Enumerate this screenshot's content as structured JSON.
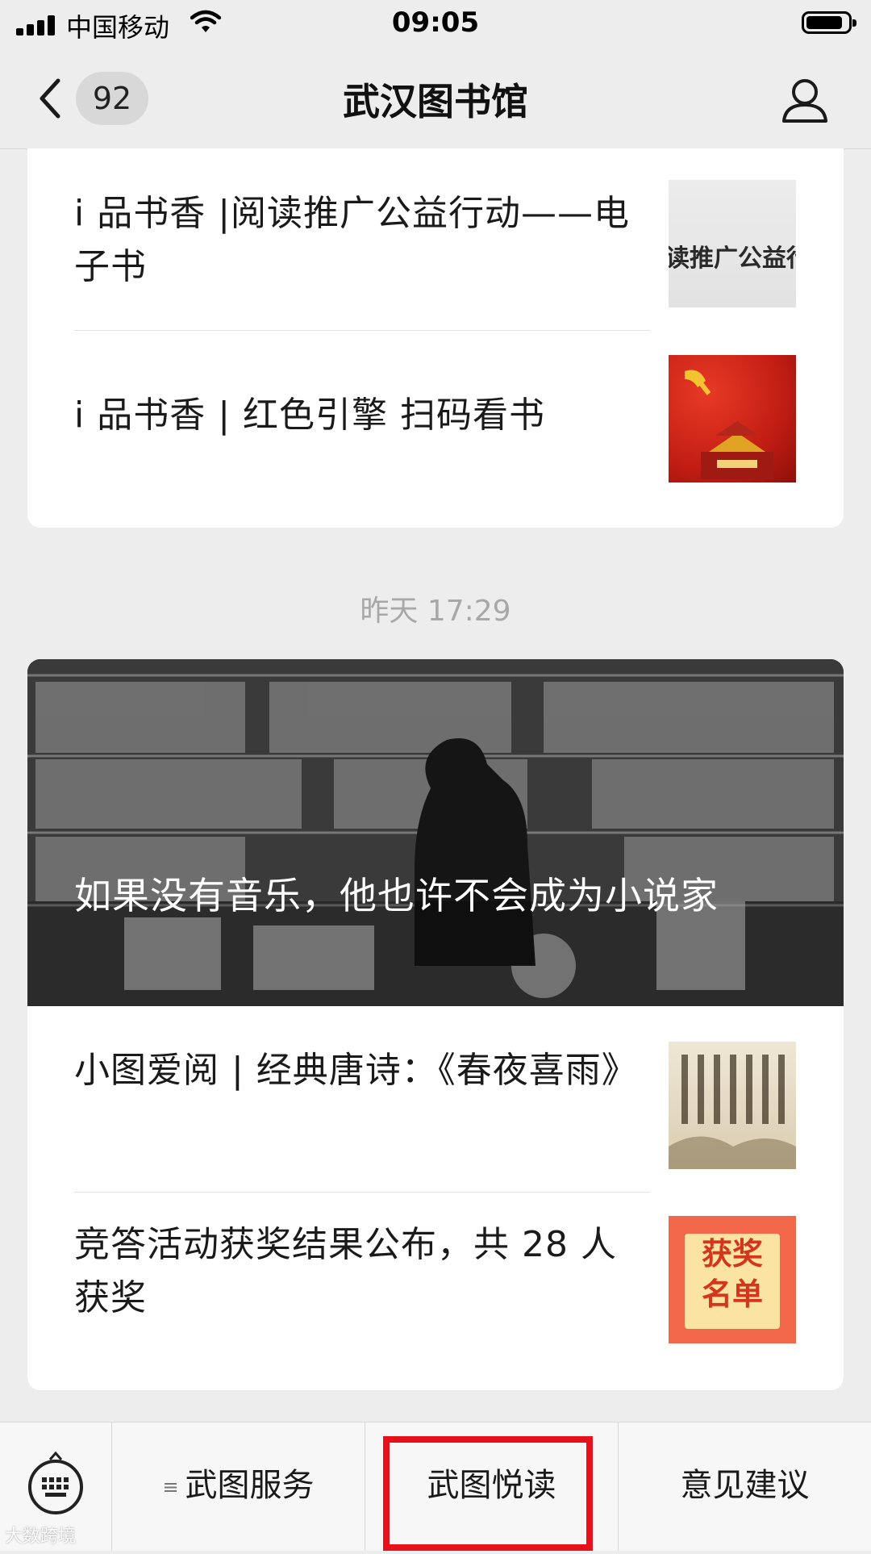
{
  "status_bar": {
    "carrier": "中国移动",
    "time": "09:05"
  },
  "nav": {
    "unread_badge": "92",
    "title": "武汉图书馆"
  },
  "card1": {
    "items": [
      {
        "title": "i 品书香 |阅读推广公益行动——电子书",
        "thumb_text": "读推广公益行"
      },
      {
        "title": "i 品书香 | 红色引擎 扫码看书"
      }
    ]
  },
  "date_label": "昨天 17:29",
  "card2": {
    "hero_title": "如果没有音乐，他也许不会成为小说家",
    "items": [
      {
        "title": "小图爱阅 | 经典唐诗：《春夜喜雨》"
      },
      {
        "title": "竞答活动获奖结果公布，共 28 人获奖",
        "thumb_text_1": "获奖",
        "thumb_text_2": "名单"
      }
    ]
  },
  "bottom_menu": [
    "武图服务",
    "武图悦读",
    "意见建议"
  ],
  "watermark": "大数跨境",
  "colors": {
    "highlight": "#e8101a",
    "background": "#ededed",
    "card": "#ffffff"
  },
  "icons": [
    "signal-icon",
    "wifi-icon",
    "battery-icon",
    "back-chevron-icon",
    "profile-icon",
    "keyboard-icon",
    "menu-lines-icon"
  ]
}
